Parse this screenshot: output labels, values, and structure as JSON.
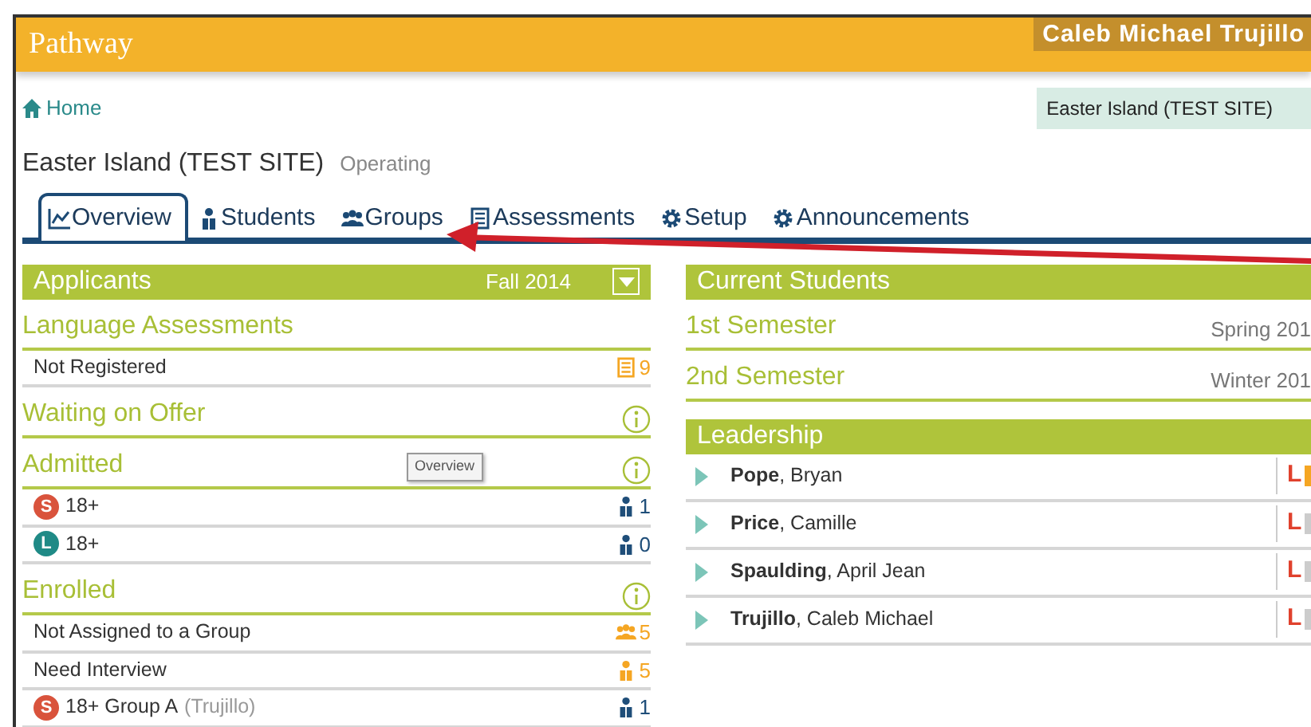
{
  "header": {
    "logo": "Pathway",
    "user": "Caleb Michael Trujillo"
  },
  "breadcrumb": {
    "label": "Home"
  },
  "site_badge": "Easter Island (TEST SITE)",
  "site": {
    "name": "Easter Island (TEST SITE)",
    "status": "Operating"
  },
  "tabs": [
    {
      "label": "Overview",
      "kind": "chart",
      "selected": true
    },
    {
      "label": "Students",
      "kind": "person",
      "selected": false
    },
    {
      "label": "Groups",
      "kind": "group",
      "selected": false
    },
    {
      "label": "Assessments",
      "kind": "list",
      "selected": false
    },
    {
      "label": "Setup",
      "kind": "gear",
      "selected": false
    },
    {
      "label": "Announcements",
      "kind": "gear",
      "selected": false
    }
  ],
  "tooltip": "Overview",
  "applicants": {
    "title": "Applicants",
    "term": "Fall 2014",
    "sections": [
      {
        "title": "Language Assessments",
        "info": false,
        "rows": [
          {
            "label": "Not Registered",
            "count": {
              "text": "9",
              "kind": "list",
              "color": "#f5a623"
            }
          }
        ]
      },
      {
        "title": "Waiting on Offer",
        "info": true
      },
      {
        "title": "Admitted",
        "info": true,
        "rows": [
          {
            "badge": {
              "letter": "S",
              "color": "#d9533c"
            },
            "label": "18+",
            "count": {
              "text": "1",
              "kind": "person",
              "color": "#1f4e79"
            }
          },
          {
            "badge": {
              "letter": "L",
              "color": "#1f8a86"
            },
            "label": "18+",
            "count": {
              "text": "0",
              "kind": "person",
              "color": "#1f4e79"
            }
          }
        ]
      },
      {
        "title": "Enrolled",
        "info": true,
        "rows": [
          {
            "label": "Not Assigned to a Group",
            "count": {
              "text": "5",
              "kind": "group",
              "color": "#f5a623"
            }
          },
          {
            "label": "Need Interview",
            "count": {
              "text": "5",
              "kind": "person",
              "color": "#f5a623"
            }
          },
          {
            "badge": {
              "letter": "S",
              "color": "#d9533c"
            },
            "label": "18+ Group A",
            "note": "(Trujillo)",
            "count": {
              "text": "1",
              "kind": "person",
              "color": "#1f4e79"
            }
          }
        ]
      }
    ]
  },
  "current": {
    "title": "Current Students",
    "semesters": [
      {
        "title": "1st Semester",
        "term": "Spring 201"
      },
      {
        "title": "2nd Semester",
        "term": "Winter 201"
      }
    ],
    "leadership": {
      "title": "Leadership",
      "rows": [
        {
          "name": "**Pope**, Bryan",
          "flag": "L",
          "color": "#f5a623"
        },
        {
          "name": "**Price**, Camille",
          "flag": "L",
          "color": "#cccccc"
        },
        {
          "name": "**Spaulding**, April Jean",
          "flag": "L",
          "color": "#cccccc"
        },
        {
          "name": "**Trujillo**, Caleb Michael",
          "flag": "L",
          "color": "#cccccc"
        }
      ]
    }
  }
}
